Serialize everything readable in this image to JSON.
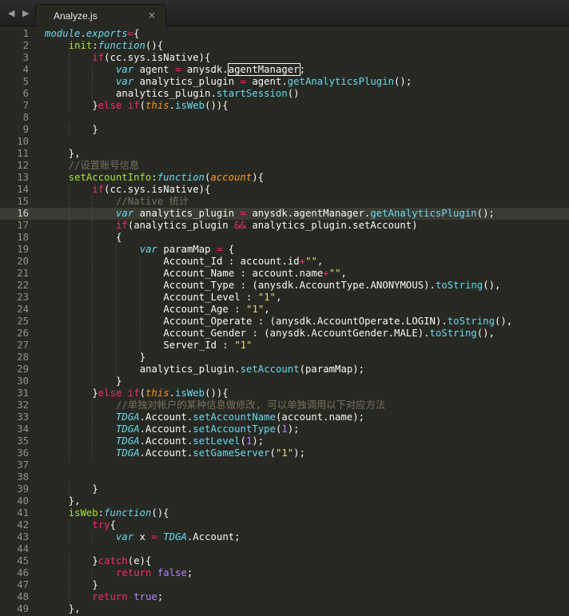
{
  "nav": {
    "arrows": "◀ ▶"
  },
  "tab": {
    "label": "Analyze.js",
    "close": "×"
  },
  "code_lines": [
    {
      "n": "1",
      "indent": 0,
      "t": [
        [
          "module",
          "store"
        ],
        [
          ".",
          "punc"
        ],
        [
          "exports",
          "store"
        ],
        [
          "=",
          "kw"
        ],
        [
          "{",
          "punc"
        ]
      ]
    },
    {
      "n": "2",
      "indent": 4,
      "t": [
        [
          "init",
          "fn"
        ],
        [
          ":",
          "punc"
        ],
        [
          "function",
          "store"
        ],
        [
          "(){",
          "punc"
        ]
      ]
    },
    {
      "n": "3",
      "indent": 8,
      "t": [
        [
          "if",
          "kw"
        ],
        [
          "(cc.sys.isNative){",
          "punc"
        ]
      ]
    },
    {
      "n": "4",
      "indent": 12,
      "t": [
        [
          "var",
          "store"
        ],
        [
          " agent ",
          "punc"
        ],
        [
          "=",
          "kw"
        ],
        [
          " anysdk.",
          "punc"
        ],
        [
          "agentManager",
          "hl"
        ],
        [
          ";",
          "punc"
        ]
      ]
    },
    {
      "n": "5",
      "indent": 12,
      "t": [
        [
          "var",
          "store"
        ],
        [
          " analytics_plugin ",
          "punc"
        ],
        [
          "=",
          "kw"
        ],
        [
          " agent.",
          "punc"
        ],
        [
          "getAnalyticsPlugin",
          "call"
        ],
        [
          "();",
          "punc"
        ]
      ]
    },
    {
      "n": "6",
      "indent": 12,
      "t": [
        [
          "analytics_plugin.",
          "punc"
        ],
        [
          "startSession",
          "call"
        ],
        [
          "()",
          "punc"
        ]
      ]
    },
    {
      "n": "7",
      "indent": 8,
      "t": [
        [
          "}",
          "punc"
        ],
        [
          "else",
          "kw"
        ],
        [
          " ",
          "punc"
        ],
        [
          "if",
          "kw"
        ],
        [
          "(",
          "punc"
        ],
        [
          "this",
          "this"
        ],
        [
          ".",
          "punc"
        ],
        [
          "isWeb",
          "call"
        ],
        [
          "()){",
          "punc"
        ]
      ]
    },
    {
      "n": "8",
      "indent": 0,
      "t": []
    },
    {
      "n": "9",
      "indent": 8,
      "t": [
        [
          "}",
          "punc"
        ]
      ]
    },
    {
      "n": "10",
      "indent": 0,
      "t": []
    },
    {
      "n": "11",
      "indent": 4,
      "t": [
        [
          "},",
          "punc"
        ]
      ]
    },
    {
      "n": "12",
      "indent": 4,
      "t": [
        [
          "//设置账号信息",
          "cm"
        ]
      ]
    },
    {
      "n": "13",
      "indent": 4,
      "t": [
        [
          "setAccountInfo",
          "fn"
        ],
        [
          ":",
          "punc"
        ],
        [
          "function",
          "store"
        ],
        [
          "(",
          "punc"
        ],
        [
          "account",
          "param"
        ],
        [
          "){",
          "punc"
        ]
      ]
    },
    {
      "n": "14",
      "indent": 8,
      "t": [
        [
          "if",
          "kw"
        ],
        [
          "(cc.sys.isNative){",
          "punc"
        ]
      ]
    },
    {
      "n": "15",
      "indent": 12,
      "t": [
        [
          "//Native 统计",
          "cm"
        ]
      ]
    },
    {
      "n": "16",
      "indent": 12,
      "t": [
        [
          "var",
          "store"
        ],
        [
          " analytics_plugin ",
          "punc"
        ],
        [
          "=",
          "kw"
        ],
        [
          " anysdk.agentManager.",
          "punc"
        ],
        [
          "getAnalyticsPlugin",
          "call"
        ],
        [
          "();",
          "punc"
        ]
      ]
    },
    {
      "n": "17",
      "indent": 12,
      "t": [
        [
          "if",
          "kw"
        ],
        [
          "(analytics_plugin ",
          "punc"
        ],
        [
          "&&",
          "kw"
        ],
        [
          " analytics_plugin.setAccount)",
          "punc"
        ]
      ]
    },
    {
      "n": "18",
      "indent": 12,
      "t": [
        [
          "{",
          "punc"
        ]
      ]
    },
    {
      "n": "19",
      "indent": 16,
      "t": [
        [
          "var",
          "store"
        ],
        [
          " paramMap ",
          "punc"
        ],
        [
          "=",
          "kw"
        ],
        [
          " {",
          "punc"
        ]
      ]
    },
    {
      "n": "20",
      "indent": 20,
      "t": [
        [
          "Account_Id : account.id",
          "punc"
        ],
        [
          "+",
          "kw"
        ],
        [
          "\"\"",
          "str"
        ],
        [
          ",",
          "punc"
        ]
      ]
    },
    {
      "n": "21",
      "indent": 20,
      "t": [
        [
          "Account_Name : account.name",
          "punc"
        ],
        [
          "+",
          "kw"
        ],
        [
          "\"\"",
          "str"
        ],
        [
          ",",
          "punc"
        ]
      ]
    },
    {
      "n": "22",
      "indent": 20,
      "t": [
        [
          "Account_Type : (anysdk.AccountType.ANONYMOUS).",
          "punc"
        ],
        [
          "toString",
          "call"
        ],
        [
          "(),",
          "punc"
        ]
      ]
    },
    {
      "n": "23",
      "indent": 20,
      "t": [
        [
          "Account_Level : ",
          "punc"
        ],
        [
          "\"1\"",
          "str"
        ],
        [
          ",",
          "punc"
        ]
      ]
    },
    {
      "n": "24",
      "indent": 20,
      "t": [
        [
          "Account_Age : ",
          "punc"
        ],
        [
          "\"1\"",
          "str"
        ],
        [
          ",",
          "punc"
        ]
      ]
    },
    {
      "n": "25",
      "indent": 20,
      "t": [
        [
          "Account_Operate : (anysdk.AccountOperate.LOGIN).",
          "punc"
        ],
        [
          "toString",
          "call"
        ],
        [
          "(),",
          "punc"
        ]
      ]
    },
    {
      "n": "26",
      "indent": 20,
      "t": [
        [
          "Account_Gender : (anysdk.AccountGender.MALE).",
          "punc"
        ],
        [
          "toString",
          "call"
        ],
        [
          "(),",
          "punc"
        ]
      ]
    },
    {
      "n": "27",
      "indent": 20,
      "t": [
        [
          "Server_Id : ",
          "punc"
        ],
        [
          "\"1\"",
          "str"
        ]
      ]
    },
    {
      "n": "28",
      "indent": 16,
      "t": [
        [
          "}",
          "punc"
        ]
      ]
    },
    {
      "n": "29",
      "indent": 16,
      "t": [
        [
          "analytics_plugin.",
          "punc"
        ],
        [
          "setAccount",
          "call"
        ],
        [
          "(paramMap);",
          "punc"
        ]
      ]
    },
    {
      "n": "30",
      "indent": 12,
      "t": [
        [
          "}",
          "punc"
        ]
      ]
    },
    {
      "n": "31",
      "indent": 8,
      "t": [
        [
          "}",
          "punc"
        ],
        [
          "else",
          "kw"
        ],
        [
          " ",
          "punc"
        ],
        [
          "if",
          "kw"
        ],
        [
          "(",
          "punc"
        ],
        [
          "this",
          "this"
        ],
        [
          ".",
          "punc"
        ],
        [
          "isWeb",
          "call"
        ],
        [
          "()){",
          "punc"
        ]
      ]
    },
    {
      "n": "32",
      "indent": 12,
      "t": [
        [
          "//单独对帐户的某种信息做修改, 可以单独调用以下对应方法",
          "cm"
        ]
      ]
    },
    {
      "n": "33",
      "indent": 12,
      "t": [
        [
          "TDGA",
          "cls"
        ],
        [
          ".Account.",
          "punc"
        ],
        [
          "setAccountName",
          "call"
        ],
        [
          "(account.name);",
          "punc"
        ]
      ]
    },
    {
      "n": "34",
      "indent": 12,
      "t": [
        [
          "TDGA",
          "cls"
        ],
        [
          ".Account.",
          "punc"
        ],
        [
          "setAccountType",
          "call"
        ],
        [
          "(",
          "punc"
        ],
        [
          "1",
          "num"
        ],
        [
          ");",
          "punc"
        ]
      ]
    },
    {
      "n": "35",
      "indent": 12,
      "t": [
        [
          "TDGA",
          "cls"
        ],
        [
          ".Account.",
          "punc"
        ],
        [
          "setLevel",
          "call"
        ],
        [
          "(",
          "punc"
        ],
        [
          "1",
          "num"
        ],
        [
          ");",
          "punc"
        ]
      ]
    },
    {
      "n": "36",
      "indent": 12,
      "t": [
        [
          "TDGA",
          "cls"
        ],
        [
          ".Account.",
          "punc"
        ],
        [
          "setGameServer",
          "call"
        ],
        [
          "(",
          "punc"
        ],
        [
          "\"1\"",
          "str"
        ],
        [
          ");",
          "punc"
        ]
      ]
    },
    {
      "n": "37",
      "indent": 0,
      "t": []
    },
    {
      "n": "38",
      "indent": 0,
      "t": []
    },
    {
      "n": "39",
      "indent": 8,
      "t": [
        [
          "}",
          "punc"
        ]
      ]
    },
    {
      "n": "40",
      "indent": 4,
      "t": [
        [
          "},",
          "punc"
        ]
      ]
    },
    {
      "n": "41",
      "indent": 4,
      "t": [
        [
          "isWeb",
          "fn"
        ],
        [
          ":",
          "punc"
        ],
        [
          "function",
          "store"
        ],
        [
          "(){",
          "punc"
        ]
      ]
    },
    {
      "n": "42",
      "indent": 8,
      "t": [
        [
          "try",
          "kw"
        ],
        [
          "{",
          "punc"
        ]
      ]
    },
    {
      "n": "43",
      "indent": 12,
      "t": [
        [
          "var",
          "store"
        ],
        [
          " x ",
          "punc"
        ],
        [
          "=",
          "kw"
        ],
        [
          " ",
          "punc"
        ],
        [
          "TDGA",
          "cls"
        ],
        [
          ".Account;",
          "punc"
        ]
      ]
    },
    {
      "n": "44",
      "indent": 0,
      "t": []
    },
    {
      "n": "45",
      "indent": 8,
      "t": [
        [
          "}",
          "punc"
        ],
        [
          "catch",
          "kw"
        ],
        [
          "(e){",
          "punc"
        ]
      ]
    },
    {
      "n": "46",
      "indent": 12,
      "t": [
        [
          "return",
          "kw"
        ],
        [
          " ",
          "punc"
        ],
        [
          "false",
          "bool"
        ],
        [
          ";",
          "punc"
        ]
      ]
    },
    {
      "n": "47",
      "indent": 8,
      "t": [
        [
          "}",
          "punc"
        ]
      ]
    },
    {
      "n": "48",
      "indent": 8,
      "t": [
        [
          "return",
          "kw"
        ],
        [
          " ",
          "punc"
        ],
        [
          "true",
          "bool"
        ],
        [
          ";",
          "punc"
        ]
      ]
    },
    {
      "n": "49",
      "indent": 4,
      "t": [
        [
          "},",
          "punc"
        ]
      ]
    }
  ],
  "active_line": "16",
  "colors": {
    "background": "#272822",
    "keyword": "#f92672",
    "storage": "#66d9ef",
    "function_name": "#a6e22e",
    "string": "#e6db74",
    "number": "#ae81ff",
    "comment": "#75715e",
    "this": "#fd971f"
  }
}
